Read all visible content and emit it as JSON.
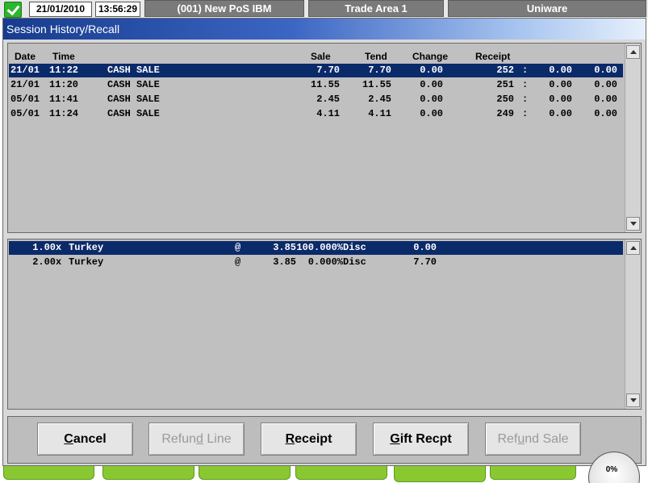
{
  "topbar": {
    "date": "21/01/2010",
    "time": "13:56:29",
    "terminal": "(001) New PoS IBM",
    "trade_area": "Trade Area 1",
    "vendor": "Uniware"
  },
  "dialog": {
    "title": "Session History/Recall"
  },
  "session_table": {
    "headers": {
      "date": "Date",
      "time": "Time",
      "sale": "Sale",
      "tend": "Tend",
      "change": "Change",
      "receipt": "Receipt"
    },
    "rows": [
      {
        "date": "21/01",
        "time": "11:22",
        "type": "CASH SALE",
        "sale": "7.70",
        "tend": "7.70",
        "change": "0.00",
        "receipt": "252",
        "colon": ":",
        "v1": "0.00",
        "v2": "0.00",
        "selected": true
      },
      {
        "date": "21/01",
        "time": "11:20",
        "type": "CASH SALE",
        "sale": "11.55",
        "tend": "11.55",
        "change": "0.00",
        "receipt": "251",
        "colon": ":",
        "v1": "0.00",
        "v2": "0.00",
        "selected": false
      },
      {
        "date": "05/01",
        "time": "11:41",
        "type": "CASH SALE",
        "sale": "2.45",
        "tend": "2.45",
        "change": "0.00",
        "receipt": "250",
        "colon": ":",
        "v1": "0.00",
        "v2": "0.00",
        "selected": false
      },
      {
        "date": "05/01",
        "time": "11:24",
        "type": "CASH SALE",
        "sale": "4.11",
        "tend": "4.11",
        "change": "0.00",
        "receipt": "249",
        "colon": ":",
        "v1": "0.00",
        "v2": "0.00",
        "selected": false
      }
    ]
  },
  "items_table": {
    "rows": [
      {
        "qty": "1.00",
        "x": "x",
        "desc": "Turkey",
        "at": "@",
        "price": "3.85",
        "disc": "100.000%",
        "disc_label": "Disc",
        "amount": "0.00",
        "selected": true
      },
      {
        "qty": "2.00",
        "x": "x",
        "desc": "Turkey",
        "at": "@",
        "price": "3.85",
        "disc": "0.000%",
        "disc_label": "Disc",
        "amount": "7.70",
        "selected": false
      }
    ]
  },
  "buttons": {
    "cancel": {
      "label_pre": "",
      "label_ul": "C",
      "label_post": "ancel"
    },
    "refund_line": {
      "label_pre": "Refun",
      "label_ul": "d",
      "label_post": " Line"
    },
    "receipt": {
      "label_pre": "",
      "label_ul": "R",
      "label_post": "eceipt"
    },
    "gift": {
      "label_pre": "",
      "label_ul": "G",
      "label_post": "ift Recpt"
    },
    "refund_sale": {
      "label_pre": "Ref",
      "label_ul": "u",
      "label_post": "nd Sale"
    }
  },
  "gauge": {
    "label": "0%"
  }
}
